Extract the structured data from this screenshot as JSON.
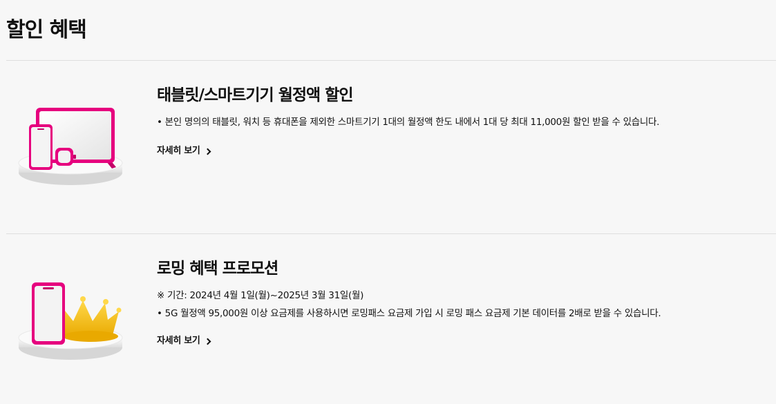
{
  "page": {
    "title": "할인 혜택"
  },
  "cards": [
    {
      "title": "태블릿/스마트기기 월정액 할인",
      "lines": [
        "• 본인 명의의 태블릿, 워치 등 휴대폰을 제외한 스마트기기 1대의 월정액 한도 내에서 1대 당 최대 11,000원 할인 받을 수 있습니다."
      ],
      "more_label": "자세히 보기",
      "illustration_icon": "tablet-phone-watch-icon"
    },
    {
      "title": "로밍 혜택 프로모션",
      "lines": [
        "※ 기간: 2024년 4월 1일(월)~2025년 3월 31일(월)",
        "• 5G 월정액 95,000원 이상 요금제를 사용하시면 로밍패스 요금제 가입 시 로밍 패스 요금제 기본 데이터를 2배로 받을 수 있습니다."
      ],
      "more_label": "자세히 보기",
      "illustration_icon": "phone-crown-icon"
    }
  ],
  "colors": {
    "accent": "#e6007e",
    "crown": "#f5c518",
    "background": "#f7f7f7",
    "divider": "#dedede"
  }
}
